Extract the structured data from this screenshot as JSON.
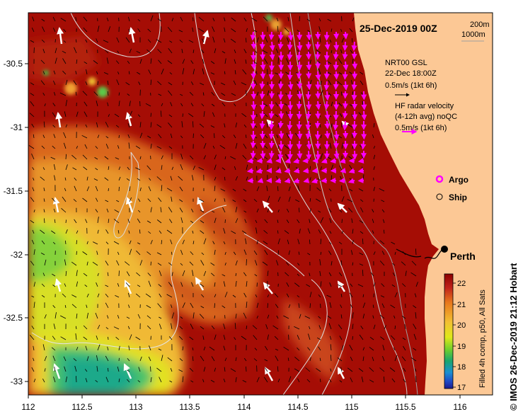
{
  "map": {
    "date_title": "25-Dec-2019 00Z",
    "isobath_legend": [
      "200m",
      "1000m"
    ],
    "gsl_legend": {
      "line1": "NRT00 GSL",
      "line2": "22-Dec 18:00Z",
      "line3": "0.5m/s (1kt 6h)"
    },
    "hf_legend": {
      "line1": "HF radar velocity",
      "line2": "(4-12h avg) noQC",
      "line3": "0.5m/s (1kt 6h)"
    },
    "symbol_legend": [
      {
        "label": "Argo",
        "color": "#ff00ff"
      },
      {
        "label": "Ship",
        "color": "#000000"
      }
    ],
    "place_label": "Perth",
    "credit": "© IMOS 26-Dec-2019 21:12 Hobart",
    "colorbar": {
      "caption": "Filled 4h comp, p50, All Sats",
      "min": 17,
      "max": 22,
      "ticks": [
        "22",
        "21",
        "20",
        "19",
        "18",
        "17"
      ]
    },
    "axes": {
      "x_ticks": [
        "112",
        "112.5",
        "113",
        "113.5",
        "114",
        "114.5",
        "115",
        "115.5",
        "116"
      ],
      "y_ticks": [
        "-30.5",
        "-31",
        "-31.5",
        "-32",
        "-32.5",
        "-33"
      ]
    },
    "colors": {
      "land": "#fcc895",
      "warm_sst": "#a50d05",
      "hf_arrow": "#ff00ff",
      "argo": "#ff00ff",
      "perth_marker": "#000000"
    }
  }
}
